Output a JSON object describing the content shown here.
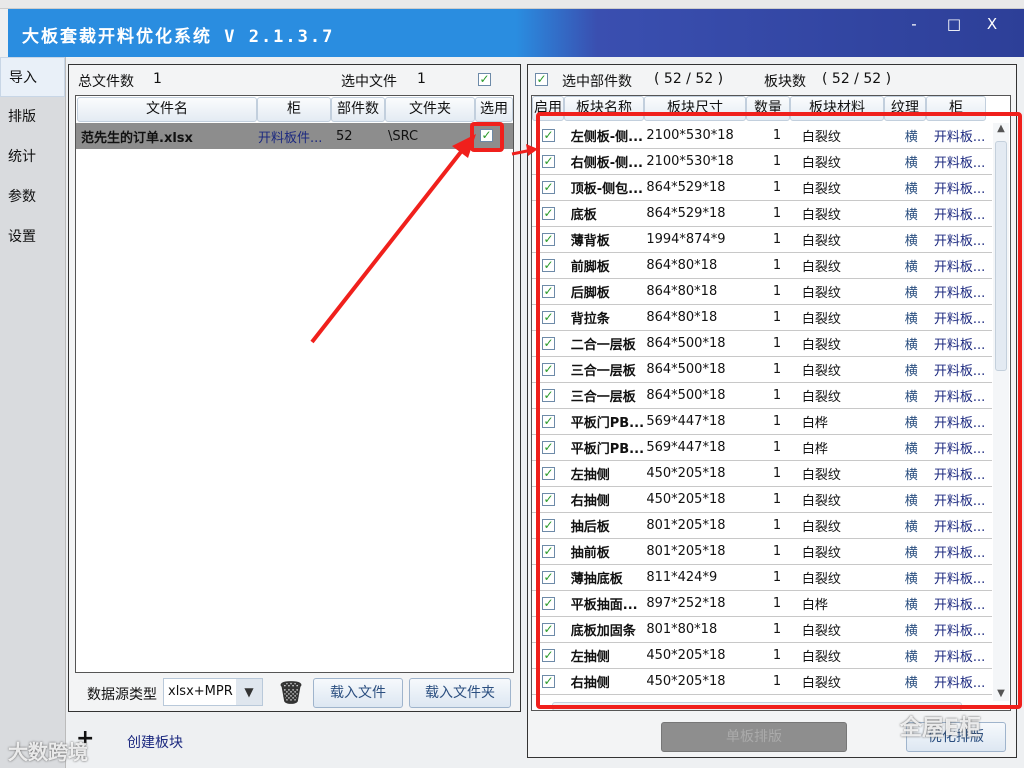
{
  "window": {
    "title": "大板套裁开料优化系统 V 2.1.3.7",
    "minimize": "-",
    "maximize": "□",
    "close": "X"
  },
  "nav": [
    {
      "label": "导入",
      "active": true
    },
    {
      "label": "排版"
    },
    {
      "label": "统计"
    },
    {
      "label": "参数"
    },
    {
      "label": "设置"
    }
  ],
  "files": {
    "total_label": "总文件数",
    "total": "1",
    "selected_label": "选中文件",
    "selected": "1",
    "columns": [
      "文件名",
      "柜",
      "部件数",
      "文件夹",
      "选用"
    ],
    "rows": [
      {
        "name": "范先生的订单.xlsx",
        "cabinet": "开料板件...",
        "parts": "52",
        "folder": "\\SRC",
        "checked": true
      }
    ],
    "source_type_label": "数据源类型",
    "source_type": "xlsx+MPR",
    "load_file": "载入文件",
    "load_folder": "载入文件夹",
    "create_block": "创建板块"
  },
  "parts": {
    "selected_label": "选中部件数",
    "selected": "( 52 / 52 )",
    "blocks_label": "板块数",
    "blocks": "( 52 / 52 )",
    "columns": [
      "启用",
      "板块名称",
      "板块尺寸",
      "数量",
      "板块材料",
      "纹理",
      "柜"
    ],
    "rows": [
      [
        "左侧板-侧...",
        "2100*530*18",
        "1",
        "白裂纹",
        "横",
        "开料板..."
      ],
      [
        "右侧板-侧...",
        "2100*530*18",
        "1",
        "白裂纹",
        "横",
        "开料板..."
      ],
      [
        "顶板-侧包...",
        "864*529*18",
        "1",
        "白裂纹",
        "横",
        "开料板..."
      ],
      [
        "底板",
        "864*529*18",
        "1",
        "白裂纹",
        "横",
        "开料板..."
      ],
      [
        "薄背板",
        "1994*874*9",
        "1",
        "白裂纹",
        "横",
        "开料板..."
      ],
      [
        "前脚板",
        "864*80*18",
        "1",
        "白裂纹",
        "横",
        "开料板..."
      ],
      [
        "后脚板",
        "864*80*18",
        "1",
        "白裂纹",
        "横",
        "开料板..."
      ],
      [
        "背拉条",
        "864*80*18",
        "1",
        "白裂纹",
        "横",
        "开料板..."
      ],
      [
        "二合一层板",
        "864*500*18",
        "1",
        "白裂纹",
        "横",
        "开料板..."
      ],
      [
        "三合一层板",
        "864*500*18",
        "1",
        "白裂纹",
        "横",
        "开料板..."
      ],
      [
        "三合一层板",
        "864*500*18",
        "1",
        "白裂纹",
        "横",
        "开料板..."
      ],
      [
        "平板门PB...",
        "569*447*18",
        "1",
        "白桦",
        "横",
        "开料板..."
      ],
      [
        "平板门PB...",
        "569*447*18",
        "1",
        "白桦",
        "横",
        "开料板..."
      ],
      [
        "左抽侧",
        "450*205*18",
        "1",
        "白裂纹",
        "横",
        "开料板..."
      ],
      [
        "右抽侧",
        "450*205*18",
        "1",
        "白裂纹",
        "横",
        "开料板..."
      ],
      [
        "抽后板",
        "801*205*18",
        "1",
        "白裂纹",
        "横",
        "开料板..."
      ],
      [
        "抽前板",
        "801*205*18",
        "1",
        "白裂纹",
        "横",
        "开料板..."
      ],
      [
        "薄抽底板",
        "811*424*9",
        "1",
        "白裂纹",
        "横",
        "开料板..."
      ],
      [
        "平板抽面...",
        "897*252*18",
        "1",
        "白桦",
        "横",
        "开料板..."
      ],
      [
        "底板加固条",
        "801*80*18",
        "1",
        "白裂纹",
        "横",
        "开料板..."
      ],
      [
        "左抽侧",
        "450*205*18",
        "1",
        "白裂纹",
        "横",
        "开料板..."
      ],
      [
        "右抽侧",
        "450*205*18",
        "1",
        "白裂纹",
        "横",
        "开料板..."
      ]
    ],
    "single_layout": "单板排版",
    "optimize_layout": "优化排版"
  },
  "watermarks": [
    "大数跨境",
    "全屋E柜"
  ],
  "colors": {
    "annotation": "#f0201c",
    "title_bar": "#2a8de0",
    "check": "#2a9a2a"
  }
}
